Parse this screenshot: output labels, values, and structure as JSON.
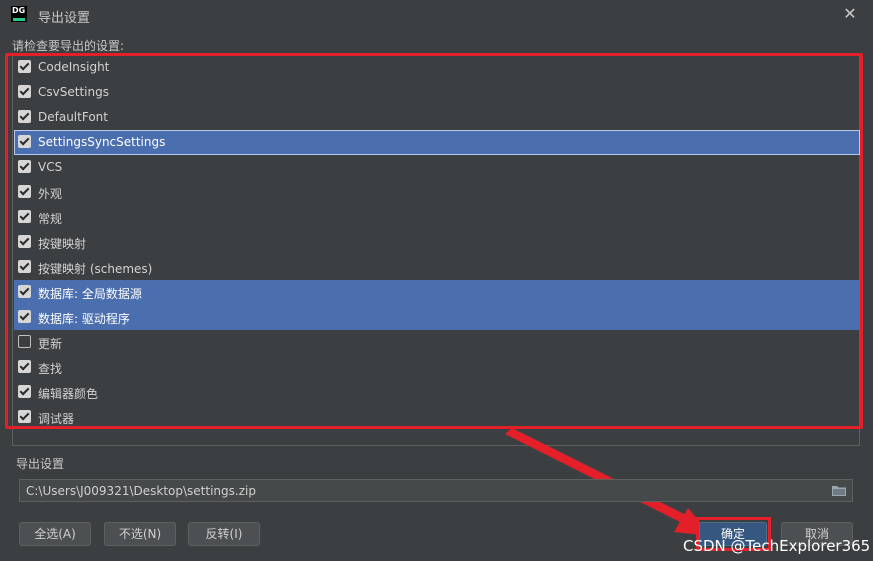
{
  "window": {
    "title": "导出设置",
    "logo_text": "DG",
    "close_glyph": "✕"
  },
  "prompt": "请检查要导出的设置:",
  "settings": [
    {
      "label": "CodeInsight",
      "checked": true,
      "selected": false
    },
    {
      "label": "CsvSettings",
      "checked": true,
      "selected": false
    },
    {
      "label": "DefaultFont",
      "checked": true,
      "selected": false
    },
    {
      "label": "SettingsSyncSettings",
      "checked": true,
      "selected": true,
      "focused": true
    },
    {
      "label": "VCS",
      "checked": true,
      "selected": false
    },
    {
      "label": "外观",
      "checked": true,
      "selected": false
    },
    {
      "label": "常规",
      "checked": true,
      "selected": false
    },
    {
      "label": "按键映射",
      "checked": true,
      "selected": false
    },
    {
      "label": "按键映射 (schemes)",
      "checked": true,
      "selected": false
    },
    {
      "label": "数据库: 全局数据源",
      "checked": true,
      "selected": true
    },
    {
      "label": "数据库: 驱动程序",
      "checked": true,
      "selected": true
    },
    {
      "label": "更新",
      "checked": false,
      "selected": false
    },
    {
      "label": "查找",
      "checked": true,
      "selected": false
    },
    {
      "label": "编辑器颜色",
      "checked": true,
      "selected": false
    },
    {
      "label": "调试器",
      "checked": true,
      "selected": false
    }
  ],
  "export": {
    "section_label": "导出设置",
    "path": "C:\\Users\\J009321\\Desktop\\settings.zip"
  },
  "buttons": {
    "select_all": "全选(A)",
    "select_none": "不选(N)",
    "invert": "反转(I)",
    "ok": "确定",
    "cancel": "取消"
  },
  "watermark": "CSDN @TechExplorer365",
  "colors": {
    "background": "#3c3f41",
    "selection": "#4b6eaf",
    "annotation_red": "#e3202a",
    "primary_button": "#365880"
  }
}
